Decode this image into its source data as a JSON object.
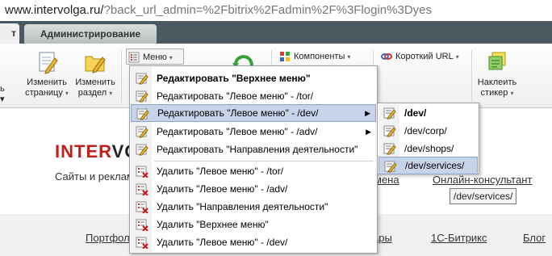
{
  "address_bar": {
    "host": "www.intervolga.ru/",
    "rest": "?back_url_admin=%2Fbitrix%2Fadmin%2F%3Flogin%3Dyes"
  },
  "tabs": {
    "view": "т",
    "admin": "Администрирование"
  },
  "toolbar": {
    "left_edge": "ь\n▾",
    "edit_page": "Изменить\nстраницу",
    "edit_section": "Изменить\nраздел",
    "menu": "Меню",
    "components": "Компоненты",
    "short_url": "Короткий URL",
    "sticker": "Наклеить\nстикер"
  },
  "page": {
    "logo_red": "INTER",
    "logo_dark": "VO",
    "slogan": "Сайты и реклама",
    "mena": "мена",
    "online": "Онлайн-консультант",
    "nav": [
      "Портфол",
      "ары",
      "1С-Битрикс",
      "Блог"
    ]
  },
  "menu": {
    "items": [
      {
        "label": "Редактировать \"Верхнее меню\"",
        "icon": "edit-icon"
      },
      {
        "label": "Редактировать \"Левое меню\" - /tor/",
        "icon": "edit-icon"
      },
      {
        "label": "Редактировать \"Левое меню\" - /dev/",
        "icon": "edit-icon"
      },
      {
        "label": "Редактировать \"Левое меню\" - /adv/",
        "icon": "edit-icon"
      },
      {
        "label": "Редактировать \"Направления деятельности\"",
        "icon": "edit-icon"
      },
      {
        "label": "Удалить \"Левое меню\" - /tor/",
        "icon": "delete-icon"
      },
      {
        "label": "Удалить \"Левое меню\" - /adv/",
        "icon": "delete-icon"
      },
      {
        "label": "Удалить \"Направления деятельности\"",
        "icon": "delete-icon"
      },
      {
        "label": "Удалить \"Верхнее меню\"",
        "icon": "delete-icon"
      },
      {
        "label": "Удалить \"Левое меню\" - /dev/",
        "icon": "delete-icon"
      }
    ],
    "highlighted_index": 2
  },
  "submenu": {
    "items": [
      "/dev/",
      "/dev/corp/",
      "/dev/shops/",
      "/dev/services/"
    ],
    "highlighted_index": 3
  },
  "tooltip": "/dev/services/"
}
